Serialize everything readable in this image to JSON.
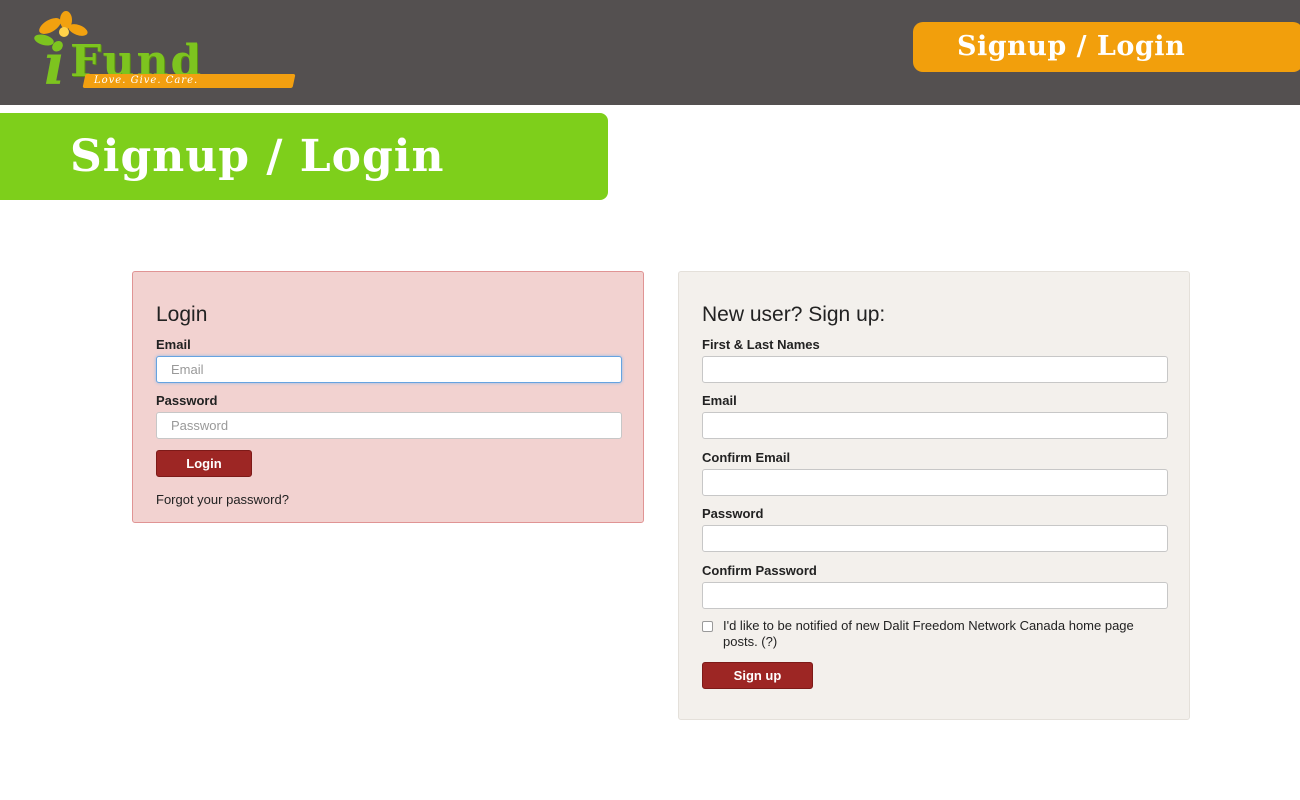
{
  "header": {
    "logo_text": "iFund",
    "logo_tagline": "Love. Give. Care.",
    "signup_login_button": "Signup / Login"
  },
  "banner": {
    "title": "Signup / Login"
  },
  "login": {
    "heading": "Login",
    "email_label": "Email",
    "email_placeholder": "Email",
    "password_label": "Password",
    "password_placeholder": "Password",
    "submit_label": "Login",
    "forgot_link": "Forgot your password?"
  },
  "signup": {
    "heading": "New user? Sign up:",
    "name_label": "First & Last Names",
    "email_label": "Email",
    "confirm_email_label": "Confirm Email",
    "password_label": "Password",
    "confirm_password_label": "Confirm Password",
    "notify_label": "I'd like to be notified of new Dalit Freedom Network Canada home page posts. (?)",
    "submit_label": "Sign up"
  },
  "colors": {
    "topbar": "#545050",
    "accent_orange": "#f29f0c",
    "accent_green": "#7ecf1b",
    "button_red": "#9d2624"
  }
}
